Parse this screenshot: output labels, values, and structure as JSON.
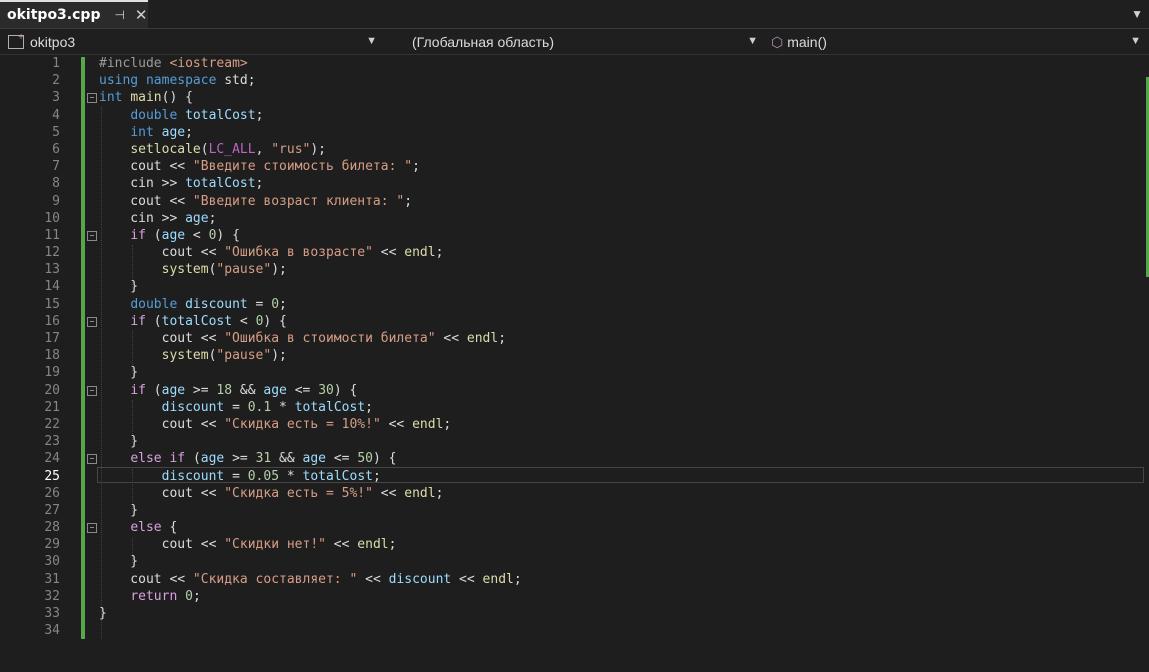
{
  "tab": {
    "title": "okitpo3.cpp",
    "pin_icon": "pin-icon",
    "close_icon": "close-icon"
  },
  "nav": {
    "project": "okitpo3",
    "scope": "(Глобальная область)",
    "member": "main()"
  },
  "editor": {
    "current_line": 25,
    "lines": [
      {
        "n": "1",
        "fold": "",
        "t": [
          [
            "pp",
            "#include "
          ],
          [
            "str",
            "<iostream>"
          ]
        ]
      },
      {
        "n": "2",
        "fold": "",
        "t": [
          [
            "kw",
            "using namespace "
          ],
          [
            "tx",
            "std;"
          ]
        ]
      },
      {
        "n": "3",
        "fold": "⊟",
        "t": [
          [
            "kw",
            "int "
          ],
          [
            "fn",
            "main"
          ],
          [
            "tx",
            "() {"
          ]
        ]
      },
      {
        "n": "4",
        "fold": "",
        "t": [
          [
            "tx",
            "    "
          ],
          [
            "kw",
            "double "
          ],
          [
            "var",
            "totalCost"
          ],
          [
            "tx",
            ";"
          ]
        ]
      },
      {
        "n": "5",
        "fold": "",
        "t": [
          [
            "tx",
            "    "
          ],
          [
            "kw",
            "int "
          ],
          [
            "var",
            "age"
          ],
          [
            "tx",
            ";"
          ]
        ]
      },
      {
        "n": "6",
        "fold": "",
        "t": [
          [
            "tx",
            "    "
          ],
          [
            "fn",
            "setlocale"
          ],
          [
            "tx",
            "("
          ],
          [
            "mac",
            "LC_ALL"
          ],
          [
            "tx",
            ", "
          ],
          [
            "str",
            "\"rus\""
          ],
          [
            "tx",
            ");"
          ]
        ]
      },
      {
        "n": "7",
        "fold": "",
        "t": [
          [
            "tx",
            "    cout << "
          ],
          [
            "str",
            "\"Введите стоимость билета: \""
          ],
          [
            "tx",
            ";"
          ]
        ]
      },
      {
        "n": "8",
        "fold": "",
        "t": [
          [
            "tx",
            "    cin >> "
          ],
          [
            "var",
            "totalCost"
          ],
          [
            "tx",
            ";"
          ]
        ]
      },
      {
        "n": "9",
        "fold": "",
        "t": [
          [
            "tx",
            "    cout << "
          ],
          [
            "str",
            "\"Введите возраст клиента: \""
          ],
          [
            "tx",
            ";"
          ]
        ]
      },
      {
        "n": "10",
        "fold": "",
        "t": [
          [
            "tx",
            "    cin >> "
          ],
          [
            "var",
            "age"
          ],
          [
            "tx",
            ";"
          ]
        ]
      },
      {
        "n": "11",
        "fold": "⊟",
        "t": [
          [
            "tx",
            "    "
          ],
          [
            "ctl",
            "if "
          ],
          [
            "tx",
            "("
          ],
          [
            "var",
            "age"
          ],
          [
            "tx",
            " < "
          ],
          [
            "num",
            "0"
          ],
          [
            "tx",
            ") {"
          ]
        ]
      },
      {
        "n": "12",
        "fold": "",
        "t": [
          [
            "tx",
            "        cout << "
          ],
          [
            "str",
            "\"Ошибка в возрасте\""
          ],
          [
            "tx",
            " << "
          ],
          [
            "fn",
            "endl"
          ],
          [
            "tx",
            ";"
          ]
        ]
      },
      {
        "n": "13",
        "fold": "",
        "t": [
          [
            "tx",
            "        "
          ],
          [
            "fn",
            "system"
          ],
          [
            "tx",
            "("
          ],
          [
            "str",
            "\"pause\""
          ],
          [
            "tx",
            ");"
          ]
        ]
      },
      {
        "n": "14",
        "fold": "",
        "t": [
          [
            "tx",
            "    }"
          ]
        ]
      },
      {
        "n": "15",
        "fold": "",
        "t": [
          [
            "tx",
            "    "
          ],
          [
            "kw",
            "double "
          ],
          [
            "var",
            "discount"
          ],
          [
            "tx",
            " = "
          ],
          [
            "num",
            "0"
          ],
          [
            "tx",
            ";"
          ]
        ]
      },
      {
        "n": "16",
        "fold": "⊟",
        "t": [
          [
            "tx",
            "    "
          ],
          [
            "ctl",
            "if "
          ],
          [
            "tx",
            "("
          ],
          [
            "var",
            "totalCost"
          ],
          [
            "tx",
            " < "
          ],
          [
            "num",
            "0"
          ],
          [
            "tx",
            ") {"
          ]
        ]
      },
      {
        "n": "17",
        "fold": "",
        "t": [
          [
            "tx",
            "        cout << "
          ],
          [
            "str",
            "\"Ошибка в стоимости билета\""
          ],
          [
            "tx",
            " << "
          ],
          [
            "fn",
            "endl"
          ],
          [
            "tx",
            ";"
          ]
        ]
      },
      {
        "n": "18",
        "fold": "",
        "t": [
          [
            "tx",
            "        "
          ],
          [
            "fn",
            "system"
          ],
          [
            "tx",
            "("
          ],
          [
            "str",
            "\"pause\""
          ],
          [
            "tx",
            ");"
          ]
        ]
      },
      {
        "n": "19",
        "fold": "",
        "t": [
          [
            "tx",
            "    }"
          ]
        ]
      },
      {
        "n": "20",
        "fold": "⊟",
        "t": [
          [
            "tx",
            "    "
          ],
          [
            "ctl",
            "if "
          ],
          [
            "tx",
            "("
          ],
          [
            "var",
            "age"
          ],
          [
            "tx",
            " >= "
          ],
          [
            "num",
            "18"
          ],
          [
            "tx",
            " && "
          ],
          [
            "var",
            "age"
          ],
          [
            "tx",
            " <= "
          ],
          [
            "num",
            "30"
          ],
          [
            "tx",
            ") {"
          ]
        ]
      },
      {
        "n": "21",
        "fold": "",
        "t": [
          [
            "tx",
            "        "
          ],
          [
            "var",
            "discount"
          ],
          [
            "tx",
            " = "
          ],
          [
            "num",
            "0.1"
          ],
          [
            "tx",
            " * "
          ],
          [
            "var",
            "totalCost"
          ],
          [
            "tx",
            ";"
          ]
        ]
      },
      {
        "n": "22",
        "fold": "",
        "t": [
          [
            "tx",
            "        cout << "
          ],
          [
            "str",
            "\"Скидка есть = 10%!\""
          ],
          [
            "tx",
            " << "
          ],
          [
            "fn",
            "endl"
          ],
          [
            "tx",
            ";"
          ]
        ]
      },
      {
        "n": "23",
        "fold": "",
        "t": [
          [
            "tx",
            "    }"
          ]
        ]
      },
      {
        "n": "24",
        "fold": "⊟",
        "t": [
          [
            "tx",
            "    "
          ],
          [
            "ctl",
            "else if "
          ],
          [
            "tx",
            "("
          ],
          [
            "var",
            "age"
          ],
          [
            "tx",
            " >= "
          ],
          [
            "num",
            "31"
          ],
          [
            "tx",
            " && "
          ],
          [
            "var",
            "age"
          ],
          [
            "tx",
            " <= "
          ],
          [
            "num",
            "50"
          ],
          [
            "tx",
            ") {"
          ]
        ]
      },
      {
        "n": "25",
        "fold": "",
        "t": [
          [
            "tx",
            "        "
          ],
          [
            "var",
            "discount"
          ],
          [
            "tx",
            " = "
          ],
          [
            "num",
            "0.05"
          ],
          [
            "tx",
            " * "
          ],
          [
            "var",
            "totalCost"
          ],
          [
            "tx",
            ";"
          ]
        ]
      },
      {
        "n": "26",
        "fold": "",
        "t": [
          [
            "tx",
            "        cout << "
          ],
          [
            "str",
            "\"Скидка есть = 5%!\""
          ],
          [
            "tx",
            " << "
          ],
          [
            "fn",
            "endl"
          ],
          [
            "tx",
            ";"
          ]
        ]
      },
      {
        "n": "27",
        "fold": "",
        "t": [
          [
            "tx",
            "    }"
          ]
        ]
      },
      {
        "n": "28",
        "fold": "⊟",
        "t": [
          [
            "tx",
            "    "
          ],
          [
            "ctl",
            "else "
          ],
          [
            "tx",
            "{"
          ]
        ]
      },
      {
        "n": "29",
        "fold": "",
        "t": [
          [
            "tx",
            "        cout << "
          ],
          [
            "str",
            "\"Скидки нет!\""
          ],
          [
            "tx",
            " << "
          ],
          [
            "fn",
            "endl"
          ],
          [
            "tx",
            ";"
          ]
        ]
      },
      {
        "n": "30",
        "fold": "",
        "t": [
          [
            "tx",
            "    }"
          ]
        ]
      },
      {
        "n": "31",
        "fold": "",
        "t": [
          [
            "tx",
            "    cout << "
          ],
          [
            "str",
            "\"Скидка составляет: \""
          ],
          [
            "tx",
            " << "
          ],
          [
            "var",
            "discount"
          ],
          [
            "tx",
            " << "
          ],
          [
            "fn",
            "endl"
          ],
          [
            "tx",
            ";"
          ]
        ]
      },
      {
        "n": "32",
        "fold": "",
        "t": [
          [
            "tx",
            "    "
          ],
          [
            "ctl",
            "return "
          ],
          [
            "num",
            "0"
          ],
          [
            "tx",
            ";"
          ]
        ]
      },
      {
        "n": "33",
        "fold": "",
        "t": [
          [
            "tx",
            "}"
          ]
        ]
      },
      {
        "n": "34",
        "fold": "",
        "t": []
      }
    ]
  }
}
